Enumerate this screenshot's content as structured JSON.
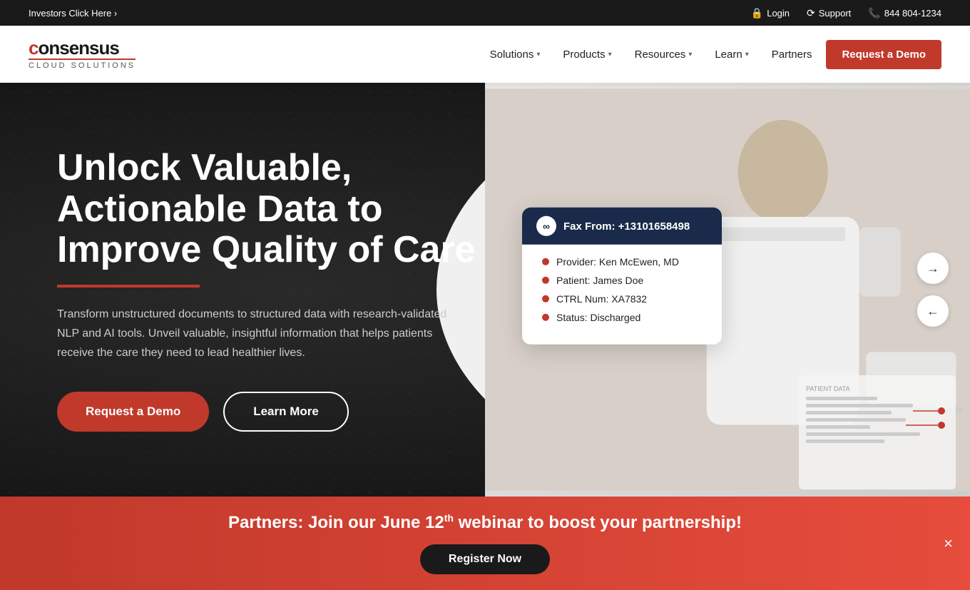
{
  "topbar": {
    "investors_link": "Investors Click Here ›",
    "login_label": "Login",
    "support_label": "Support",
    "phone": "844 804-1234"
  },
  "navbar": {
    "logo_main": "consensus",
    "logo_sub": "Cloud Solutions",
    "nav_items": [
      {
        "id": "solutions",
        "label": "Solutions",
        "has_dropdown": true
      },
      {
        "id": "products",
        "label": "Products",
        "has_dropdown": true
      },
      {
        "id": "resources",
        "label": "Resources",
        "has_dropdown": true
      },
      {
        "id": "learn",
        "label": "Learn",
        "has_dropdown": true
      },
      {
        "id": "partners",
        "label": "Partners",
        "has_dropdown": false
      }
    ],
    "cta_label": "Request a Demo"
  },
  "hero": {
    "title": "Unlock Valuable, Actionable Data to Improve Quality of Care",
    "description": "Transform unstructured documents to structured data with research-validated NLP and AI tools. Unveil valuable, insightful information that helps patients receive the care they need to lead healthier lives.",
    "btn_demo": "Request a Demo",
    "btn_learn": "Learn More",
    "fax_card": {
      "header": "Fax From: +13101658498",
      "logo_icon": "∞",
      "rows": [
        {
          "label": "Provider: Ken McEwen, MD"
        },
        {
          "label": "Patient: James Doe"
        },
        {
          "label": "CTRL Num: XA7832"
        },
        {
          "label": "Status: Discharged"
        }
      ]
    }
  },
  "banner": {
    "text_before": "Partners: Join our June 12",
    "superscript": "th",
    "text_after": " webinar to boost your partnership!",
    "cta_label": "Register Now",
    "close_label": "×"
  }
}
